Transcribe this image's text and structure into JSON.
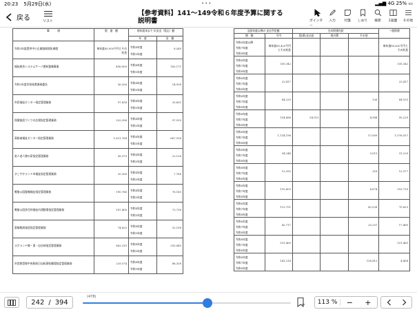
{
  "status_bar": {
    "time": "20:23",
    "date": "5月29日(水)",
    "network": "4G",
    "battery": "25%",
    "dots": "•••"
  },
  "toolbar": {
    "back_label": "戻る",
    "list_label": "リスト",
    "title": "【参考資料】141～149令和６年度予算に関する説明書",
    "tools": [
      {
        "icon": "pointer-icon",
        "label": "ポインター"
      },
      {
        "icon": "pen-icon",
        "label": "入力"
      },
      {
        "icon": "sticky-note-icon",
        "label": "付箋"
      },
      {
        "icon": "bookmark-icon",
        "label": "しおり"
      },
      {
        "icon": "search-icon",
        "label": "検索"
      },
      {
        "icon": "two-page-icon",
        "label": "2画面"
      },
      {
        "icon": "more-icon",
        "label": "その他"
      }
    ]
  },
  "left_page": {
    "headers": {
      "col1": "事　　　項",
      "col2": "限　度　額",
      "col3": "前年度末まで の支出（見込）額",
      "col3a": "年　度",
      "col3b": "金　額"
    },
    "rows": [
      {
        "name": "令和3年度提供中小企業融資損失補償",
        "limit": "毎年度80,950千円とその利息",
        "years": [
          "令和4年度",
          "令和5年度"
        ],
        "amount": "8,549"
      },
      {
        "name": "福祉総合システムサーバ更新整備事業",
        "limit": "496,000",
        "years": [
          "令和4年度",
          "令和5年度"
        ],
        "amount": "165,171"
      },
      {
        "name": "令和3年度学校給食業務委託",
        "limit": "36,356",
        "years": [
          "令和4年度",
          "令和5年度"
        ],
        "amount": "14,938"
      },
      {
        "name": "市民福祉センター指定管理業務",
        "limit": "97,838",
        "years": [
          "令和4年度",
          "令和5年度"
        ],
        "amount": "33,601"
      },
      {
        "name": "保健施設づくりの広場指定管理業務",
        "limit": "252,596",
        "years": [
          "令和4年度",
          "令和5年度"
        ],
        "amount": "97,910"
      },
      {
        "name": "高齢者福祉センター指定管理業務",
        "limit": "1,621,764",
        "years": [
          "令和4年度",
          "令和5年度"
        ],
        "amount": "667,538"
      },
      {
        "name": "老人老人館の家指定管理業務",
        "limit": "56,370",
        "years": [
          "令和4年度",
          "令和5年度"
        ],
        "amount": "22,126"
      },
      {
        "name": "すこやかランド市福祉指定管理業務",
        "limit": "20,356",
        "years": [
          "令和4年度",
          "令和5年度"
        ],
        "amount": "7,766"
      },
      {
        "name": "戦後公園整備福祉指定管理業務",
        "limit": "190,786",
        "years": [
          "令和4年度",
          "令和5年度"
        ],
        "amount": "76,165"
      },
      {
        "name": "戦後公園多目的福祉内運動場指定管理業務",
        "limit": "187,400",
        "years": [
          "令和4年度",
          "令和5年度"
        ],
        "amount": "73,738"
      },
      {
        "name": "東御殿前施設指定管理業務",
        "limit": "74,825",
        "years": [
          "令和4年度",
          "令和5年度"
        ],
        "amount": "32,108"
      },
      {
        "name": "スポランド郷・東・自治体指定管理業務",
        "limit": "862,310",
        "years": [
          "令和4年度",
          "令和5年度"
        ],
        "amount": "330,845"
      },
      {
        "name": "市営都営線中央駅前日自転車駐輪場指定管理業務",
        "limit": "229,574",
        "years": [
          "令和4年度",
          "令和5年度"
        ],
        "amount": "88,358"
      }
    ]
  },
  "right_page": {
    "headers": {
      "col1": "当該年度以降の 支出予定額",
      "col1a": "期　間",
      "col2": "左の財源内訳",
      "col2a": "特　定　財　源",
      "col2b": "国(県)支出金",
      "col2c": "地方債",
      "col2d": "その他",
      "col3": "一般財源",
      "unit": "千円"
    },
    "rows": [
      {
        "period": "令和6年度以降",
        "amount": "毎年度80,420千円とその利息",
        "kokko": "",
        "chihousai": "",
        "other": "",
        "general": "毎年度80,420千円とその利息"
      },
      {
        "period": "令和6年度",
        "amount": "330,342",
        "kokko": "",
        "chihousai": "",
        "other": "",
        "general": "330,342"
      },
      {
        "period": "令和6年度",
        "amount": "23,417",
        "kokko": "",
        "chihousai": "",
        "other": "",
        "general": "23,417"
      },
      {
        "period": "令和6年度",
        "amount": "64,229",
        "kokko": "",
        "chihousai": "",
        "other": "126",
        "general": "64,103"
      },
      {
        "period": "令和6年度",
        "amount": "154,686",
        "kokko": "54,513",
        "chihousai": "",
        "other": "4,944",
        "general": "95,229"
      },
      {
        "period": "令和6年度",
        "amount": "1,134,196",
        "kokko": "",
        "chihousai": "",
        "other": "57,609",
        "general": "1,076,557"
      },
      {
        "period": "令和6年度",
        "amount": "34,244",
        "kokko": "",
        "chihousai": "",
        "other": "3,015",
        "general": "31,229"
      },
      {
        "period": "令和6年度",
        "amount": "12,593",
        "kokko": "",
        "chihousai": "",
        "other": "216",
        "general": "12,377"
      },
      {
        "period": "令和6年度",
        "amount": "110,603",
        "kokko": "",
        "chihousai": "",
        "other": "6,874",
        "general": "103,729"
      },
      {
        "period": "令和6年度",
        "amount": "113,751",
        "kokko": "",
        "chihousai": "",
        "other": "42,028",
        "general": "70,823"
      },
      {
        "period": "令和6年度",
        "amount": "42,717",
        "kokko": "",
        "chihousai": "",
        "other": "25,257",
        "general": "17,460"
      },
      {
        "period": "令和6年度",
        "amount": "531,465",
        "kokko": "",
        "chihousai": "",
        "other": "",
        "general": "531,465"
      },
      {
        "period": "令和6年度",
        "amount": "141,216",
        "kokko": "",
        "chihousai": "",
        "other": "136,812",
        "general": "4,404"
      }
    ],
    "years_next": [
      "令和7年度",
      "令和8年度"
    ]
  },
  "bottom_bar": {
    "page_current": "242",
    "page_total": "394",
    "page_separator": "/",
    "slider_mark": "(478)",
    "slider_fraction": 0.6,
    "zoom": "113 %",
    "zoom_minus": "−",
    "zoom_plus": "+"
  },
  "colors": {
    "accent": "#2f7de1"
  }
}
